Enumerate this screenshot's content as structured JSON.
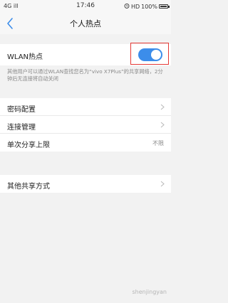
{
  "status_bar": {
    "network": "4G",
    "signal": "ill",
    "time": "17:46",
    "hd": "HD",
    "battery_percent": "100%"
  },
  "nav": {
    "title": "个人热点"
  },
  "wlan": {
    "label": "WLAN热点",
    "enabled": true,
    "hint": "其他用户可以通过WLAN查找您名为“vivo X7Plus”的共享网络，2分钟后无连接将自动关闭"
  },
  "settings": {
    "password": "密码配置",
    "connection": "连接管理",
    "share_limit": "单次分享上限",
    "share_limit_value": "不限",
    "other_methods": "其他共享方式"
  },
  "watermark": "shenjingyan",
  "colors": {
    "accent": "#3c8dea",
    "highlight": "#e53935"
  }
}
